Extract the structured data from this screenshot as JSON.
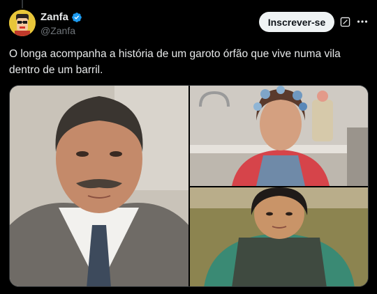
{
  "author": {
    "display_name": "Zanfa",
    "handle": "@Zanfa",
    "verified": true
  },
  "actions": {
    "follow_label": "Inscrever-se"
  },
  "tweet": {
    "text": "O longa acompanha a história de um garoto órfão que vive numa vila dentro de um barril."
  },
  "media": {
    "count": 3
  },
  "colors": {
    "verified_badge": "#1d9bf0",
    "background": "#000000",
    "text": "#e7e9ea",
    "secondary_text": "#71767b",
    "follow_button_bg": "#eff3f4"
  }
}
